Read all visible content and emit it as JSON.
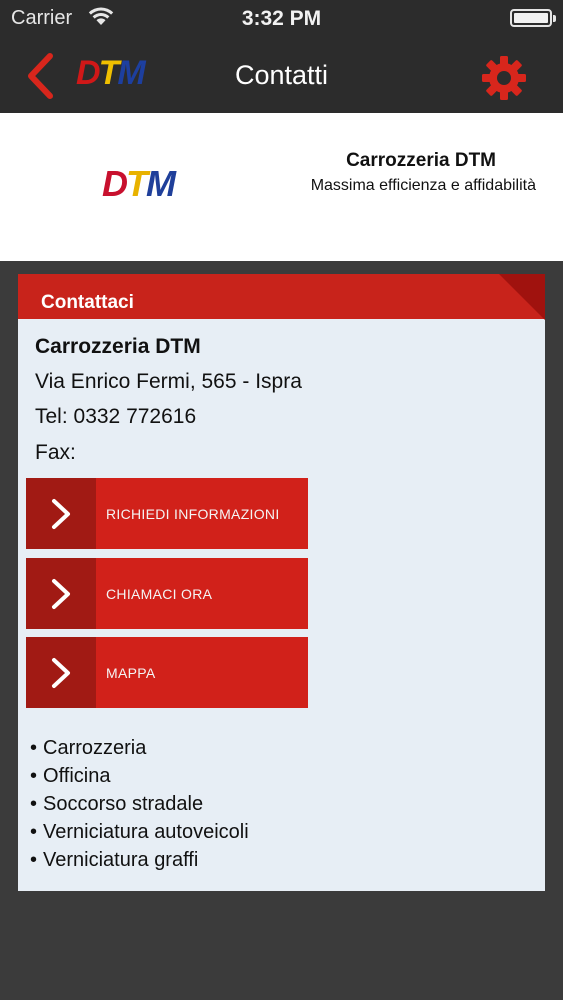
{
  "status_bar": {
    "carrier": "Carrier",
    "time": "3:32 PM"
  },
  "nav": {
    "title": "Contatti",
    "logo": {
      "d": "D",
      "t": "T",
      "m": "M"
    },
    "back_icon": "chevron-left-icon",
    "settings_icon": "gear-icon"
  },
  "header": {
    "logo": {
      "d": "D",
      "t": "T",
      "m": "M"
    },
    "company": "Carrozzeria DTM",
    "slogan": "Massima efficienza e affidabilità"
  },
  "contact": {
    "section_title": "Contattaci",
    "name": "Carrozzeria DTM",
    "address": "Via Enrico Fermi, 565 - Ispra",
    "tel": "Tel: 0332 772616",
    "fax": "Fax:"
  },
  "actions": [
    {
      "label": "RICHIEDI INFORMAZIONI",
      "icon": "chevron-right-icon"
    },
    {
      "label": "CHIAMACI ORA",
      "icon": "chevron-right-icon"
    },
    {
      "label": "MAPPA",
      "icon": "chevron-right-icon"
    }
  ],
  "services": [
    "Carrozzeria",
    "Officina",
    "Soccorso stradale",
    "Verniciatura autoveicoli",
    "Verniciatura graffi"
  ],
  "colors": {
    "accent_red": "#c8231b",
    "dark_red": "#a11a14",
    "background": "#3b3b3b",
    "card": "#e7eef5"
  }
}
